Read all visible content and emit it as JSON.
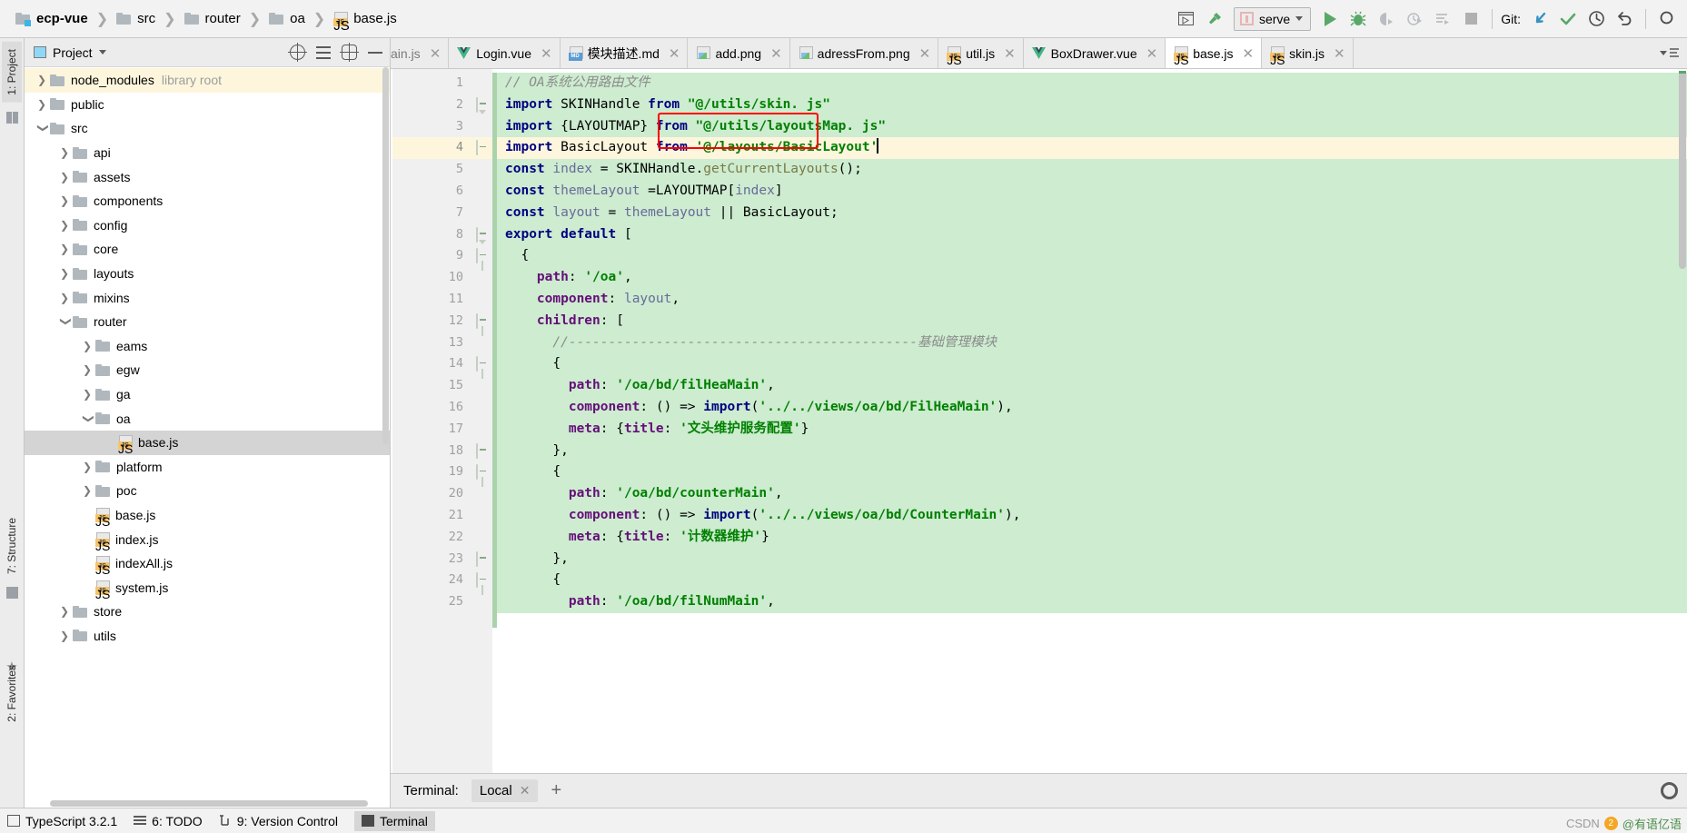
{
  "breadcrumb": {
    "items": [
      {
        "label": "ecp-vue",
        "icon": "module-folder-icon",
        "bold": true
      },
      {
        "label": "src",
        "icon": "folder-icon",
        "bold": false
      },
      {
        "label": "router",
        "icon": "folder-icon",
        "bold": false
      },
      {
        "label": "oa",
        "icon": "folder-icon",
        "bold": false
      },
      {
        "label": "base.js",
        "icon": "js-file-icon",
        "bold": false
      }
    ]
  },
  "toolbar": {
    "run_config": "serve",
    "git_label": "Git:",
    "buttons": [
      "select-opened-file-icon",
      "build-hammer-icon",
      "run-icon",
      "debug-icon",
      "run-coverage-icon",
      "profile-icon",
      "run-dashboard-icon",
      "stop-icon",
      "git-update-icon",
      "git-commit-icon",
      "git-history-icon",
      "git-rollback-icon",
      "search-everywhere-icon"
    ]
  },
  "left_tool_window": {
    "tabs": [
      "1: Project",
      "7: Structure",
      "2: Favorites"
    ]
  },
  "project_panel": {
    "title": "Project",
    "tree": [
      {
        "label": "node_modules",
        "sub": "library root",
        "indent": 1,
        "arrow": "right",
        "icon": "folder-icon",
        "state": "highlight"
      },
      {
        "label": "public",
        "sub": "",
        "indent": 1,
        "arrow": "right",
        "icon": "folder-icon",
        "state": ""
      },
      {
        "label": "src",
        "sub": "",
        "indent": 1,
        "arrow": "down",
        "icon": "folder-icon",
        "state": ""
      },
      {
        "label": "api",
        "sub": "",
        "indent": 2,
        "arrow": "right",
        "icon": "folder-icon",
        "state": ""
      },
      {
        "label": "assets",
        "sub": "",
        "indent": 2,
        "arrow": "right",
        "icon": "folder-icon",
        "state": ""
      },
      {
        "label": "components",
        "sub": "",
        "indent": 2,
        "arrow": "right",
        "icon": "folder-icon",
        "state": ""
      },
      {
        "label": "config",
        "sub": "",
        "indent": 2,
        "arrow": "right",
        "icon": "folder-icon",
        "state": ""
      },
      {
        "label": "core",
        "sub": "",
        "indent": 2,
        "arrow": "right",
        "icon": "folder-icon",
        "state": ""
      },
      {
        "label": "layouts",
        "sub": "",
        "indent": 2,
        "arrow": "right",
        "icon": "folder-icon",
        "state": ""
      },
      {
        "label": "mixins",
        "sub": "",
        "indent": 2,
        "arrow": "right",
        "icon": "folder-icon",
        "state": ""
      },
      {
        "label": "router",
        "sub": "",
        "indent": 2,
        "arrow": "down",
        "icon": "folder-icon",
        "state": ""
      },
      {
        "label": "eams",
        "sub": "",
        "indent": 3,
        "arrow": "right",
        "icon": "folder-icon",
        "state": ""
      },
      {
        "label": "egw",
        "sub": "",
        "indent": 3,
        "arrow": "right",
        "icon": "folder-icon",
        "state": ""
      },
      {
        "label": "ga",
        "sub": "",
        "indent": 3,
        "arrow": "right",
        "icon": "folder-icon",
        "state": ""
      },
      {
        "label": "oa",
        "sub": "",
        "indent": 3,
        "arrow": "down",
        "icon": "folder-icon",
        "state": ""
      },
      {
        "label": "base.js",
        "sub": "",
        "indent": 4,
        "arrow": "none",
        "icon": "js-file-icon",
        "state": "selected"
      },
      {
        "label": "platform",
        "sub": "",
        "indent": 3,
        "arrow": "right",
        "icon": "folder-icon",
        "state": ""
      },
      {
        "label": "poc",
        "sub": "",
        "indent": 3,
        "arrow": "right",
        "icon": "folder-icon",
        "state": ""
      },
      {
        "label": "base.js",
        "sub": "",
        "indent": 3,
        "arrow": "none",
        "icon": "js-file-icon",
        "state": ""
      },
      {
        "label": "index.js",
        "sub": "",
        "indent": 3,
        "arrow": "none",
        "icon": "js-file-icon",
        "state": ""
      },
      {
        "label": "indexAll.js",
        "sub": "",
        "indent": 3,
        "arrow": "none",
        "icon": "js-file-icon",
        "state": ""
      },
      {
        "label": "system.js",
        "sub": "",
        "indent": 3,
        "arrow": "none",
        "icon": "js-file-icon",
        "state": ""
      },
      {
        "label": "store",
        "sub": "",
        "indent": 2,
        "arrow": "right",
        "icon": "folder-icon",
        "state": ""
      },
      {
        "label": "utils",
        "sub": "",
        "indent": 2,
        "arrow": "right",
        "icon": "folder-icon",
        "state": ""
      }
    ]
  },
  "editor_tabs": [
    {
      "label": "ain.js",
      "icon": "js-file-icon",
      "active": false,
      "clipped": true
    },
    {
      "label": "Login.vue",
      "icon": "vue-file-icon",
      "active": false,
      "clipped": false
    },
    {
      "label": "模块描述.md",
      "icon": "md-file-icon",
      "active": false,
      "clipped": false
    },
    {
      "label": "add.png",
      "icon": "png-file-icon",
      "active": false,
      "clipped": false
    },
    {
      "label": "adressFrom.png",
      "icon": "png-file-icon",
      "active": false,
      "clipped": false
    },
    {
      "label": "util.js",
      "icon": "js-file-icon",
      "active": false,
      "clipped": false
    },
    {
      "label": "BoxDrawer.vue",
      "icon": "vue-file-icon",
      "active": false,
      "clipped": false
    },
    {
      "label": "base.js",
      "icon": "js-file-icon",
      "active": true,
      "clipped": false
    },
    {
      "label": "skin.js",
      "icon": "js-file-icon",
      "active": false,
      "clipped": false
    }
  ],
  "code": {
    "first_line": 1,
    "current_line": 4,
    "lines": [
      {
        "n": 1,
        "changed": true,
        "fold": "none",
        "tokens": [
          {
            "t": "// OA系统公用路由文件",
            "c": "c"
          }
        ]
      },
      {
        "n": 2,
        "changed": true,
        "fold": "startT",
        "tokens": [
          {
            "t": "import",
            "c": "k"
          },
          {
            "t": " SKINHandle ",
            "c": "n"
          },
          {
            "t": "from",
            "c": "k"
          },
          {
            "t": " ",
            "c": "n"
          },
          {
            "t": "\"@/utils/skin. js\"",
            "c": "s"
          }
        ]
      },
      {
        "n": 3,
        "changed": true,
        "fold": "none",
        "tokens": [
          {
            "t": "import",
            "c": "k"
          },
          {
            "t": " {LAYOUTMAP} ",
            "c": "n"
          },
          {
            "t": "from",
            "c": "k"
          },
          {
            "t": " ",
            "c": "n"
          },
          {
            "t": "\"@/utils/layoutsMap. js\"",
            "c": "s"
          }
        ]
      },
      {
        "n": 4,
        "changed": true,
        "fold": "endB",
        "tokens": [
          {
            "t": "import",
            "c": "k"
          },
          {
            "t": " BasicLayout ",
            "c": "n"
          },
          {
            "t": "from",
            "c": "k"
          },
          {
            "t": " ",
            "c": "n"
          },
          {
            "t": "'@/layouts/BasicLayout'",
            "c": "s"
          }
        ]
      },
      {
        "n": 5,
        "changed": true,
        "fold": "none",
        "tokens": [
          {
            "t": "const",
            "c": "k"
          },
          {
            "t": " ",
            "c": "n"
          },
          {
            "t": "index",
            "c": "v"
          },
          {
            "t": " = SKINHandle.",
            "c": "n"
          },
          {
            "t": "getCurrentLayouts",
            "c": "f"
          },
          {
            "t": "();",
            "c": "n"
          }
        ]
      },
      {
        "n": 6,
        "changed": true,
        "fold": "none",
        "tokens": [
          {
            "t": "const",
            "c": "k"
          },
          {
            "t": " ",
            "c": "n"
          },
          {
            "t": "themeLayout",
            "c": "v"
          },
          {
            "t": " =LAYOUTMAP[",
            "c": "n"
          },
          {
            "t": "index",
            "c": "v"
          },
          {
            "t": "]",
            "c": "n"
          }
        ]
      },
      {
        "n": 7,
        "changed": true,
        "fold": "none",
        "tokens": [
          {
            "t": "const",
            "c": "k"
          },
          {
            "t": " ",
            "c": "n"
          },
          {
            "t": "layout",
            "c": "v"
          },
          {
            "t": " = ",
            "c": "n"
          },
          {
            "t": "themeLayout",
            "c": "v"
          },
          {
            "t": " || BasicLayout;",
            "c": "n"
          }
        ]
      },
      {
        "n": 8,
        "changed": true,
        "fold": "startT",
        "tokens": [
          {
            "t": "export default",
            "c": "k"
          },
          {
            "t": " [",
            "c": "n"
          }
        ]
      },
      {
        "n": 9,
        "changed": true,
        "fold": "start",
        "tokens": [
          {
            "t": "  {",
            "c": "n"
          }
        ]
      },
      {
        "n": 10,
        "changed": true,
        "fold": "none",
        "tokens": [
          {
            "t": "    ",
            "c": "n"
          },
          {
            "t": "path",
            "c": "p"
          },
          {
            "t": ": ",
            "c": "n"
          },
          {
            "t": "'/oa'",
            "c": "s"
          },
          {
            "t": ",",
            "c": "n"
          }
        ]
      },
      {
        "n": 11,
        "changed": true,
        "fold": "none",
        "tokens": [
          {
            "t": "    ",
            "c": "n"
          },
          {
            "t": "component",
            "c": "p"
          },
          {
            "t": ": ",
            "c": "n"
          },
          {
            "t": "layout",
            "c": "v"
          },
          {
            "t": ",",
            "c": "n"
          }
        ]
      },
      {
        "n": 12,
        "changed": true,
        "fold": "start",
        "tokens": [
          {
            "t": "    ",
            "c": "n"
          },
          {
            "t": "children",
            "c": "p"
          },
          {
            "t": ": [",
            "c": "n"
          }
        ]
      },
      {
        "n": 13,
        "changed": true,
        "fold": "none",
        "tokens": [
          {
            "t": "      //--------------------------------------------基础管理模块",
            "c": "c"
          }
        ]
      },
      {
        "n": 14,
        "changed": true,
        "fold": "start",
        "tokens": [
          {
            "t": "      {",
            "c": "n"
          }
        ]
      },
      {
        "n": 15,
        "changed": true,
        "fold": "none",
        "tokens": [
          {
            "t": "        ",
            "c": "n"
          },
          {
            "t": "path",
            "c": "p"
          },
          {
            "t": ": ",
            "c": "n"
          },
          {
            "t": "'/oa/bd/filHeaMain'",
            "c": "s"
          },
          {
            "t": ",",
            "c": "n"
          }
        ]
      },
      {
        "n": 16,
        "changed": true,
        "fold": "none",
        "tokens": [
          {
            "t": "        ",
            "c": "n"
          },
          {
            "t": "component",
            "c": "p"
          },
          {
            "t": ": () => ",
            "c": "n"
          },
          {
            "t": "import",
            "c": "k"
          },
          {
            "t": "(",
            "c": "n"
          },
          {
            "t": "'../../views/oa/bd/FilHeaMain'",
            "c": "s"
          },
          {
            "t": "),",
            "c": "n"
          }
        ]
      },
      {
        "n": 17,
        "changed": true,
        "fold": "none",
        "tokens": [
          {
            "t": "        ",
            "c": "n"
          },
          {
            "t": "meta",
            "c": "p"
          },
          {
            "t": ": {",
            "c": "n"
          },
          {
            "t": "title",
            "c": "p"
          },
          {
            "t": ": ",
            "c": "n"
          },
          {
            "t": "'文头维护服务配置'",
            "c": "s"
          },
          {
            "t": "}",
            "c": "n"
          }
        ]
      },
      {
        "n": 18,
        "changed": true,
        "fold": "endB",
        "tokens": [
          {
            "t": "      },",
            "c": "n"
          }
        ]
      },
      {
        "n": 19,
        "changed": true,
        "fold": "start",
        "tokens": [
          {
            "t": "      {",
            "c": "n"
          }
        ]
      },
      {
        "n": 20,
        "changed": true,
        "fold": "none",
        "tokens": [
          {
            "t": "        ",
            "c": "n"
          },
          {
            "t": "path",
            "c": "p"
          },
          {
            "t": ": ",
            "c": "n"
          },
          {
            "t": "'/oa/bd/counterMain'",
            "c": "s"
          },
          {
            "t": ",",
            "c": "n"
          }
        ]
      },
      {
        "n": 21,
        "changed": true,
        "fold": "none",
        "tokens": [
          {
            "t": "        ",
            "c": "n"
          },
          {
            "t": "component",
            "c": "p"
          },
          {
            "t": ": () => ",
            "c": "n"
          },
          {
            "t": "import",
            "c": "k"
          },
          {
            "t": "(",
            "c": "n"
          },
          {
            "t": "'../../views/oa/bd/CounterMain'",
            "c": "s"
          },
          {
            "t": "),",
            "c": "n"
          }
        ]
      },
      {
        "n": 22,
        "changed": true,
        "fold": "none",
        "tokens": [
          {
            "t": "        ",
            "c": "n"
          },
          {
            "t": "meta",
            "c": "p"
          },
          {
            "t": ": {",
            "c": "n"
          },
          {
            "t": "title",
            "c": "p"
          },
          {
            "t": ": ",
            "c": "n"
          },
          {
            "t": "'计数器维护'",
            "c": "s"
          },
          {
            "t": "}",
            "c": "n"
          }
        ]
      },
      {
        "n": 23,
        "changed": true,
        "fold": "endB",
        "tokens": [
          {
            "t": "      },",
            "c": "n"
          }
        ]
      },
      {
        "n": 24,
        "changed": true,
        "fold": "start",
        "tokens": [
          {
            "t": "      {",
            "c": "n"
          }
        ]
      },
      {
        "n": 25,
        "changed": true,
        "fold": "none",
        "tokens": [
          {
            "t": "        ",
            "c": "n"
          },
          {
            "t": "path",
            "c": "p"
          },
          {
            "t": ": ",
            "c": "n"
          },
          {
            "t": "'/oa/bd/filNumMain'",
            "c": "s"
          },
          {
            "t": ",",
            "c": "n"
          }
        ]
      }
    ]
  },
  "terminal": {
    "label": "Terminal:",
    "tab": "Local"
  },
  "statusbar": {
    "items": [
      {
        "label": "TypeScript 3.2.1",
        "icon": "typescript-icon",
        "active": false
      },
      {
        "label": "6: TODO",
        "icon": "todo-icon",
        "active": false
      },
      {
        "label": "9: Version Control",
        "icon": "vcs-icon",
        "active": false
      },
      {
        "label": "Terminal",
        "icon": "terminal-icon",
        "active": true
      }
    ]
  },
  "watermark": {
    "text_left": "CSDN",
    "text_right": "@有语亿语",
    "badge": "2"
  },
  "colors": {
    "accent_green": "#59a869",
    "changed_line_bg": "#cdecd0",
    "current_line_bg": "#fdf6dd",
    "error_box": "#ff0000",
    "git_blue": "#3592c4"
  }
}
